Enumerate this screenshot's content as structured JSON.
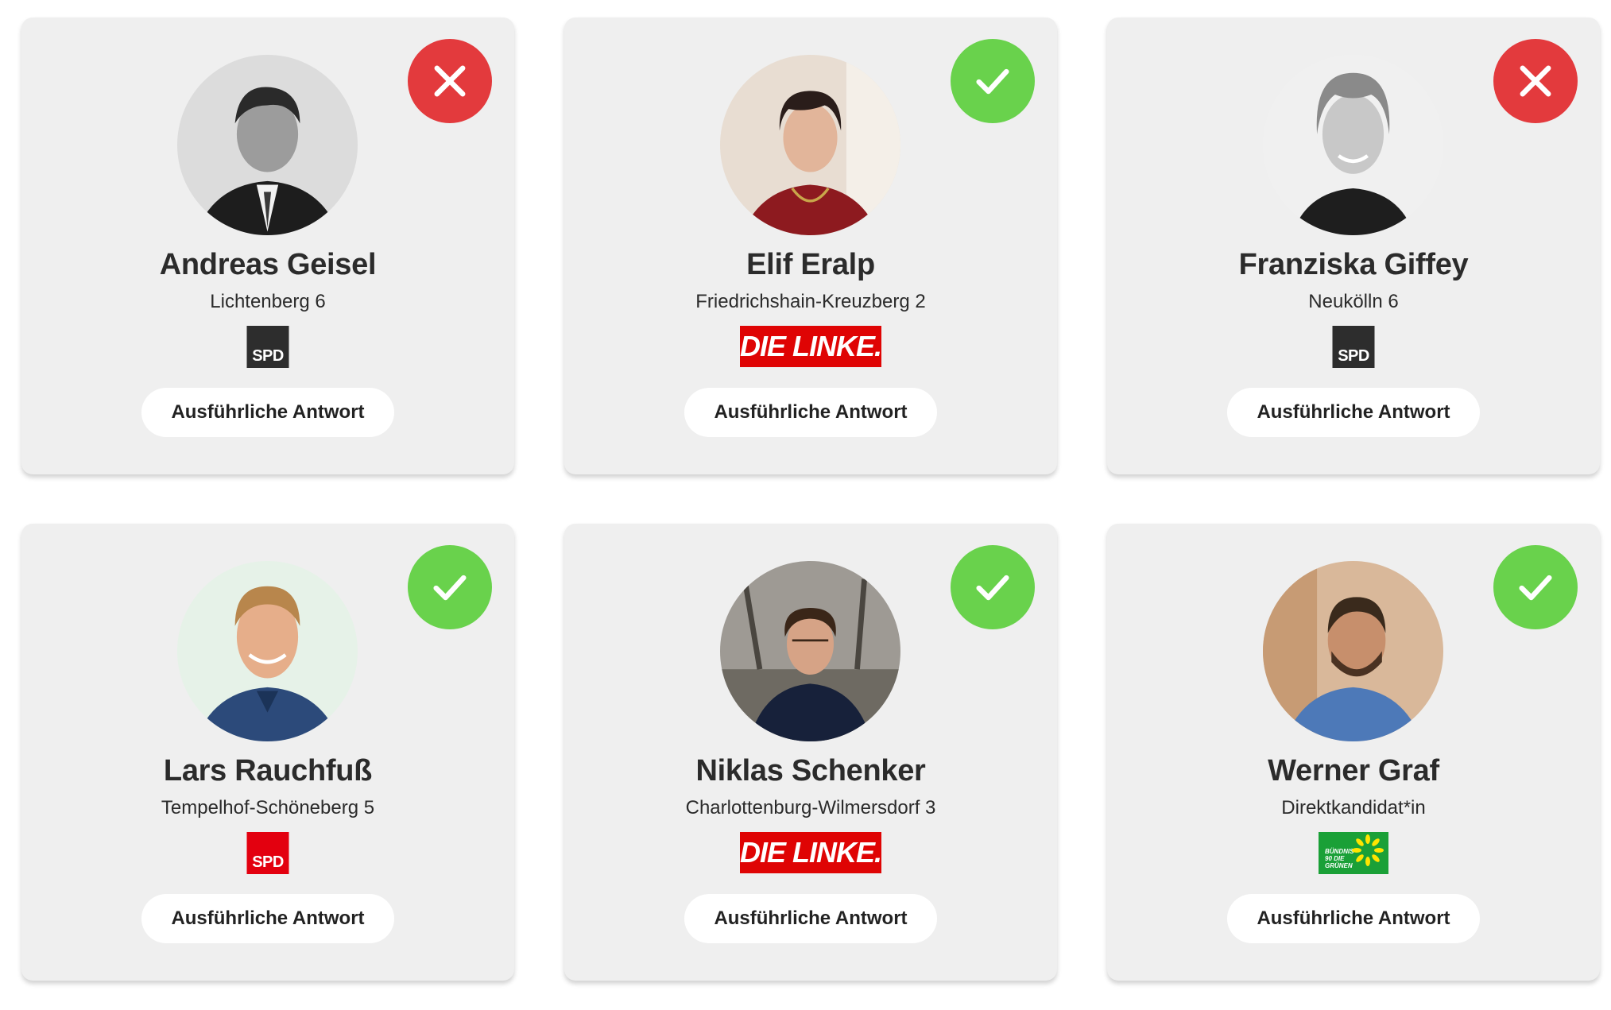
{
  "button_label": "Ausführliche Antwort",
  "colors": {
    "agree": "#69d24c",
    "disagree": "#e33a3d",
    "card_background": "#efefef"
  },
  "candidates": [
    {
      "name": "Andreas Geisel",
      "district": "Lichtenberg 6",
      "party_logo": "SPD",
      "party_style": "spd-bw",
      "answer": "disagree",
      "answer_icon": "cross-icon"
    },
    {
      "name": "Elif Eralp",
      "district": "Friedrichshain-Kreuzberg 2",
      "party_logo": "DIE LINKE.",
      "party_style": "linke",
      "answer": "agree",
      "answer_icon": "check-icon"
    },
    {
      "name": "Franziska Giffey",
      "district": "Neukölln 6",
      "party_logo": "SPD",
      "party_style": "spd-bw",
      "answer": "disagree",
      "answer_icon": "cross-icon"
    },
    {
      "name": "Lars Rauchfuß",
      "district": "Tempelhof-Schöneberg 5",
      "party_logo": "SPD",
      "party_style": "spd-red",
      "answer": "agree",
      "answer_icon": "check-icon"
    },
    {
      "name": "Niklas Schenker",
      "district": "Charlottenburg-Wilmersdorf 3",
      "party_logo": "DIE LINKE.",
      "party_style": "linke",
      "answer": "agree",
      "answer_icon": "check-icon"
    },
    {
      "name": "Werner Graf",
      "district": "Direktkandidat*in",
      "party_logo": "BÜNDNIS 90 DIE GRÜNEN",
      "party_style": "gruene",
      "answer": "agree",
      "answer_icon": "check-icon"
    }
  ]
}
